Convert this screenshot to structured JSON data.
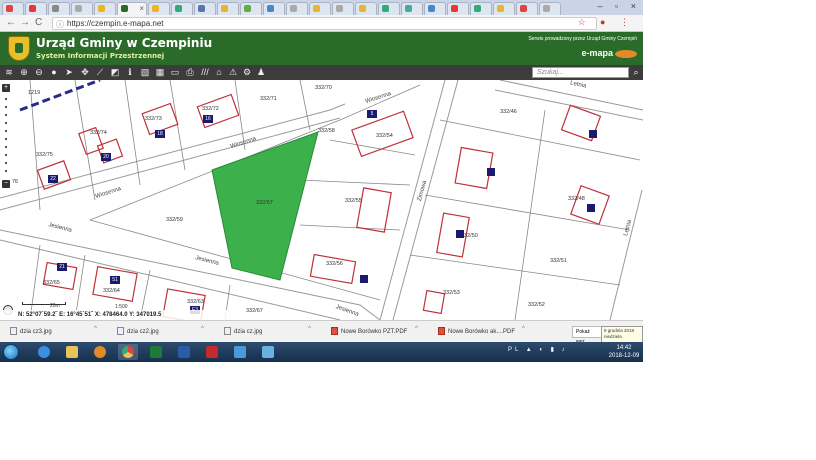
{
  "browser": {
    "tab_close": "×",
    "url": "https://czempin.e-mapa.net",
    "window_controls": "– ▫ ×",
    "nav": {
      "back": "←",
      "forward": "→",
      "reload": "C"
    }
  },
  "header": {
    "title": "Urząd Gminy w Czempiniu",
    "subtitle": "System Informacji Przestrzennej",
    "service_text": "Serwis prowadzony przez Urząd Gminy Czempiń",
    "logo_text": "e-mapa"
  },
  "toolbar": {
    "search_placeholder": "Szukaj..."
  },
  "map": {
    "parcels": [
      {
        "label": "1219"
      },
      {
        "label": "332/75"
      },
      {
        "label": "332/74"
      },
      {
        "label": "332/73"
      },
      {
        "label": "332/72"
      },
      {
        "label": "332/71"
      },
      {
        "label": "332/70"
      },
      {
        "label": "332/58"
      },
      {
        "label": "332/54"
      },
      {
        "label": "332/46"
      },
      {
        "label": "332/59"
      },
      {
        "label": "332/57"
      },
      {
        "label": "332/55"
      },
      {
        "label": "332/56"
      },
      {
        "label": "332/50"
      },
      {
        "label": "332/51"
      },
      {
        "label": "332/48"
      },
      {
        "label": "332/53"
      },
      {
        "label": "332/52"
      },
      {
        "label": "332/65"
      },
      {
        "label": "332/64"
      },
      {
        "label": "332/63"
      },
      {
        "label": "332/67"
      },
      {
        "label": "76"
      }
    ],
    "house_numbers": [
      "22",
      "20",
      "18",
      "16",
      "5",
      "21",
      "51",
      "E3"
    ],
    "streets": [
      "Wiosenna",
      "Wiosenna",
      "Wiosenna",
      "Jesienna",
      "Jesienna",
      "Jesienna",
      "Letnia",
      "Zimowa",
      "Letnia"
    ],
    "highlight_color": "#3cb04a",
    "scale_label": "20m",
    "scale_ratio": "1:500",
    "coordinates": "N: 52°07´59.2˝ E: 16°45´51˝   X: 478464.0 Y: 347019.5"
  },
  "downloads": {
    "items": [
      {
        "name": "dzia cz3.jpg",
        "type": "jpg"
      },
      {
        "name": "dzia cz2.jpg",
        "type": "jpg"
      },
      {
        "name": "dzia cz.jpg",
        "type": "jpg"
      },
      {
        "name": "Nowe Borówko PZT.PDF",
        "type": "pdf"
      },
      {
        "name": "Nowe Borówko ak....PDF",
        "type": "pdf"
      }
    ],
    "show_all": "Pokaż wsz...",
    "tooltip_date": "9 grudnia 2018",
    "tooltip_day": "niedziela"
  },
  "taskbar": {
    "tray": "PL ▲ ◐ ▮ ♪",
    "time": "14:42",
    "date": "2018-12-09"
  }
}
